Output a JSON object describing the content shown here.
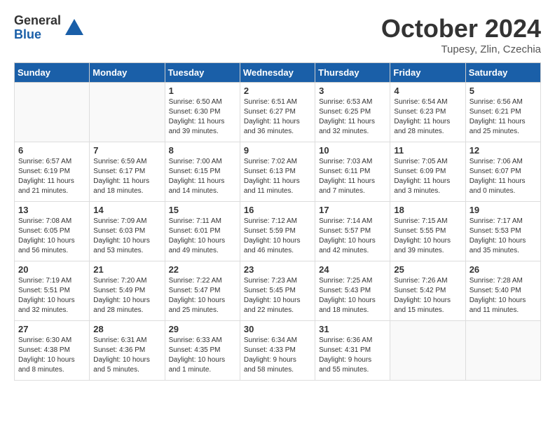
{
  "logo": {
    "general": "General",
    "blue": "Blue"
  },
  "title": "October 2024",
  "location": "Tupesy, Zlin, Czechia",
  "weekdays": [
    "Sunday",
    "Monday",
    "Tuesday",
    "Wednesday",
    "Thursday",
    "Friday",
    "Saturday"
  ],
  "weeks": [
    [
      {
        "day": "",
        "info": ""
      },
      {
        "day": "",
        "info": ""
      },
      {
        "day": "1",
        "info": "Sunrise: 6:50 AM\nSunset: 6:30 PM\nDaylight: 11 hours\nand 39 minutes."
      },
      {
        "day": "2",
        "info": "Sunrise: 6:51 AM\nSunset: 6:27 PM\nDaylight: 11 hours\nand 36 minutes."
      },
      {
        "day": "3",
        "info": "Sunrise: 6:53 AM\nSunset: 6:25 PM\nDaylight: 11 hours\nand 32 minutes."
      },
      {
        "day": "4",
        "info": "Sunrise: 6:54 AM\nSunset: 6:23 PM\nDaylight: 11 hours\nand 28 minutes."
      },
      {
        "day": "5",
        "info": "Sunrise: 6:56 AM\nSunset: 6:21 PM\nDaylight: 11 hours\nand 25 minutes."
      }
    ],
    [
      {
        "day": "6",
        "info": "Sunrise: 6:57 AM\nSunset: 6:19 PM\nDaylight: 11 hours\nand 21 minutes."
      },
      {
        "day": "7",
        "info": "Sunrise: 6:59 AM\nSunset: 6:17 PM\nDaylight: 11 hours\nand 18 minutes."
      },
      {
        "day": "8",
        "info": "Sunrise: 7:00 AM\nSunset: 6:15 PM\nDaylight: 11 hours\nand 14 minutes."
      },
      {
        "day": "9",
        "info": "Sunrise: 7:02 AM\nSunset: 6:13 PM\nDaylight: 11 hours\nand 11 minutes."
      },
      {
        "day": "10",
        "info": "Sunrise: 7:03 AM\nSunset: 6:11 PM\nDaylight: 11 hours\nand 7 minutes."
      },
      {
        "day": "11",
        "info": "Sunrise: 7:05 AM\nSunset: 6:09 PM\nDaylight: 11 hours\nand 3 minutes."
      },
      {
        "day": "12",
        "info": "Sunrise: 7:06 AM\nSunset: 6:07 PM\nDaylight: 11 hours\nand 0 minutes."
      }
    ],
    [
      {
        "day": "13",
        "info": "Sunrise: 7:08 AM\nSunset: 6:05 PM\nDaylight: 10 hours\nand 56 minutes."
      },
      {
        "day": "14",
        "info": "Sunrise: 7:09 AM\nSunset: 6:03 PM\nDaylight: 10 hours\nand 53 minutes."
      },
      {
        "day": "15",
        "info": "Sunrise: 7:11 AM\nSunset: 6:01 PM\nDaylight: 10 hours\nand 49 minutes."
      },
      {
        "day": "16",
        "info": "Sunrise: 7:12 AM\nSunset: 5:59 PM\nDaylight: 10 hours\nand 46 minutes."
      },
      {
        "day": "17",
        "info": "Sunrise: 7:14 AM\nSunset: 5:57 PM\nDaylight: 10 hours\nand 42 minutes."
      },
      {
        "day": "18",
        "info": "Sunrise: 7:15 AM\nSunset: 5:55 PM\nDaylight: 10 hours\nand 39 minutes."
      },
      {
        "day": "19",
        "info": "Sunrise: 7:17 AM\nSunset: 5:53 PM\nDaylight: 10 hours\nand 35 minutes."
      }
    ],
    [
      {
        "day": "20",
        "info": "Sunrise: 7:19 AM\nSunset: 5:51 PM\nDaylight: 10 hours\nand 32 minutes."
      },
      {
        "day": "21",
        "info": "Sunrise: 7:20 AM\nSunset: 5:49 PM\nDaylight: 10 hours\nand 28 minutes."
      },
      {
        "day": "22",
        "info": "Sunrise: 7:22 AM\nSunset: 5:47 PM\nDaylight: 10 hours\nand 25 minutes."
      },
      {
        "day": "23",
        "info": "Sunrise: 7:23 AM\nSunset: 5:45 PM\nDaylight: 10 hours\nand 22 minutes."
      },
      {
        "day": "24",
        "info": "Sunrise: 7:25 AM\nSunset: 5:43 PM\nDaylight: 10 hours\nand 18 minutes."
      },
      {
        "day": "25",
        "info": "Sunrise: 7:26 AM\nSunset: 5:42 PM\nDaylight: 10 hours\nand 15 minutes."
      },
      {
        "day": "26",
        "info": "Sunrise: 7:28 AM\nSunset: 5:40 PM\nDaylight: 10 hours\nand 11 minutes."
      }
    ],
    [
      {
        "day": "27",
        "info": "Sunrise: 6:30 AM\nSunset: 4:38 PM\nDaylight: 10 hours\nand 8 minutes."
      },
      {
        "day": "28",
        "info": "Sunrise: 6:31 AM\nSunset: 4:36 PM\nDaylight: 10 hours\nand 5 minutes."
      },
      {
        "day": "29",
        "info": "Sunrise: 6:33 AM\nSunset: 4:35 PM\nDaylight: 10 hours\nand 1 minute."
      },
      {
        "day": "30",
        "info": "Sunrise: 6:34 AM\nSunset: 4:33 PM\nDaylight: 9 hours\nand 58 minutes."
      },
      {
        "day": "31",
        "info": "Sunrise: 6:36 AM\nSunset: 4:31 PM\nDaylight: 9 hours\nand 55 minutes."
      },
      {
        "day": "",
        "info": ""
      },
      {
        "day": "",
        "info": ""
      }
    ]
  ]
}
